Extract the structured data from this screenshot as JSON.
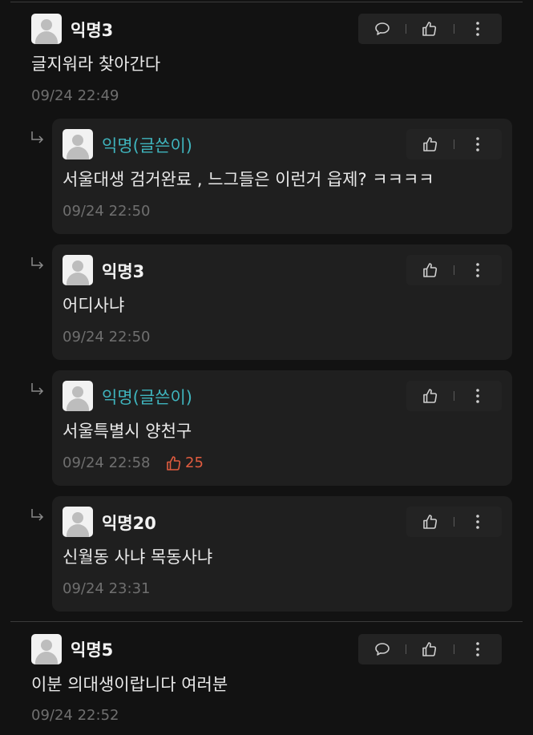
{
  "comments": [
    {
      "name": "익명3",
      "text": "글지워라 찾아간다",
      "time": "09/24 22:49",
      "replies": [
        {
          "name": "익명(글쓴이)",
          "is_author": true,
          "text": "서울대생 검거완료 , 느그들은 이런거 읍제? ㅋㅋㅋㅋ",
          "time": "09/24 22:50"
        },
        {
          "name": "익명3",
          "is_author": false,
          "text": "어디사냐",
          "time": "09/24 22:50"
        },
        {
          "name": "익명(글쓴이)",
          "is_author": true,
          "text": "서울특별시 양천구",
          "time": "09/24 22:58",
          "likes": "25"
        },
        {
          "name": "익명20",
          "is_author": false,
          "text": "신월동 사냐 목동사냐",
          "time": "09/24 23:31"
        }
      ]
    },
    {
      "name": "익명5",
      "text": "이분 의대생이랍니다 여러분",
      "time": "09/24 22:52"
    }
  ],
  "icons": {
    "reply": "comment-bubble-icon",
    "like": "thumbs-up-icon",
    "more": "more-vertical-icon",
    "reply_indicator": "reply-arrow-icon"
  },
  "colors": {
    "background": "#121212",
    "card": "#1f1f1f",
    "author": "#3fb4bd",
    "like_count": "#e25c3f"
  }
}
